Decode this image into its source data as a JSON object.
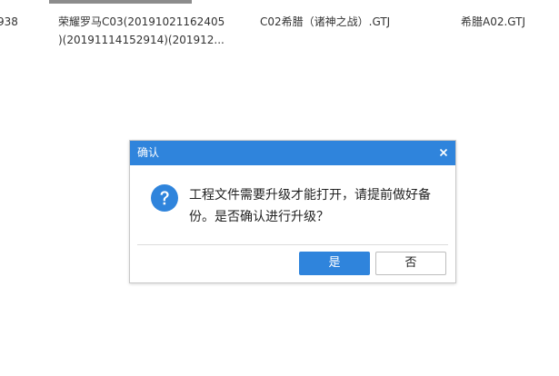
{
  "files": [
    {
      "lines": [
        "938"
      ]
    },
    {
      "lines": [
        "荣耀罗马C03(20191021162405",
        ")(20191114152914)(201912..."
      ]
    },
    {
      "lines": [
        "C02希腊（诸神之战）.GTJ"
      ]
    },
    {
      "lines": [
        "希腊A02.GTJ"
      ]
    }
  ],
  "dialog": {
    "title": "确认",
    "message_lines": [
      "工程文件需要升级才能打开，请提前做好备",
      "份。是否确认进行升级？"
    ],
    "yes_label": "是",
    "no_label": "否",
    "icon": "question-icon",
    "close_icon": "close-icon"
  },
  "colors": {
    "accent": "#2f84dc",
    "titlebar": "#2f84dc",
    "text": "#222222"
  }
}
